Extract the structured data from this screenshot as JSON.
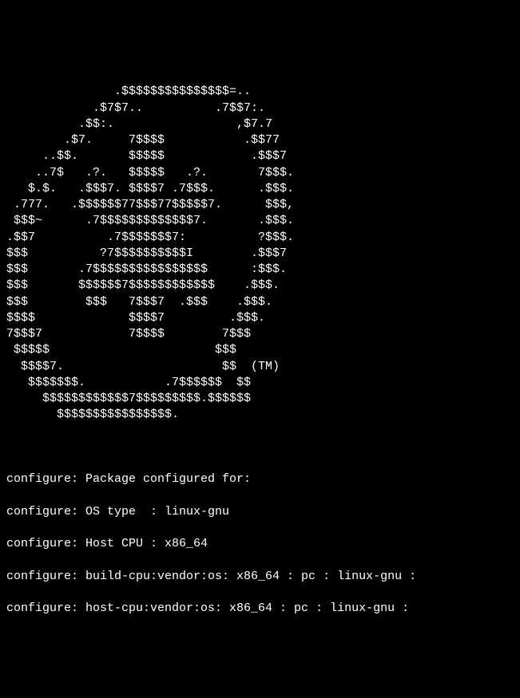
{
  "ascii_art": [
    "               .$$$$$$$$$$$$$$$=..",
    "            .$7$7..          .7$$7:.",
    "          .$$:.                 ,$7.7",
    "        .$7.     7$$$$           .$$77",
    "     ..$$.       $$$$$            .$$$7",
    "    ..7$   .?.   $$$$$   .?.       7$$$.",
    "   $.$.   .$$$7. $$$$7 .7$$$.      .$$$.",
    " .777.   .$$$$$$77$$$77$$$$$7.      $$$,",
    " $$$~      .7$$$$$$$$$$$$$7.       .$$$.",
    ".$$7          .7$$$$$$$7:          ?$$$.",
    "$$$          ?7$$$$$$$$$$I        .$$$7",
    "$$$       .7$$$$$$$$$$$$$$$$      :$$$.",
    "$$$       $$$$$$7$$$$$$$$$$$$    .$$$.",
    "$$$        $$$   7$$$7  .$$$    .$$$.",
    "$$$$             $$$$7         .$$$.",
    "7$$$7            7$$$$        7$$$",
    " $$$$$                       $$$",
    "  $$$$7.                      $$  (TM)",
    "   $$$$$$$.           .7$$$$$$  $$",
    "     $$$$$$$$$$$$7$$$$$$$$$.$$$$$$",
    "       $$$$$$$$$$$$$$$$."
  ],
  "config_lines": [
    "configure: Package configured for:",
    "configure: OS type  : linux-gnu",
    "configure: Host CPU : x86_64",
    "configure: build-cpu:vendor:os: x86_64 : pc : linux-gnu :",
    "configure: host-cpu:vendor:os: x86_64 : pc : linux-gnu :"
  ]
}
